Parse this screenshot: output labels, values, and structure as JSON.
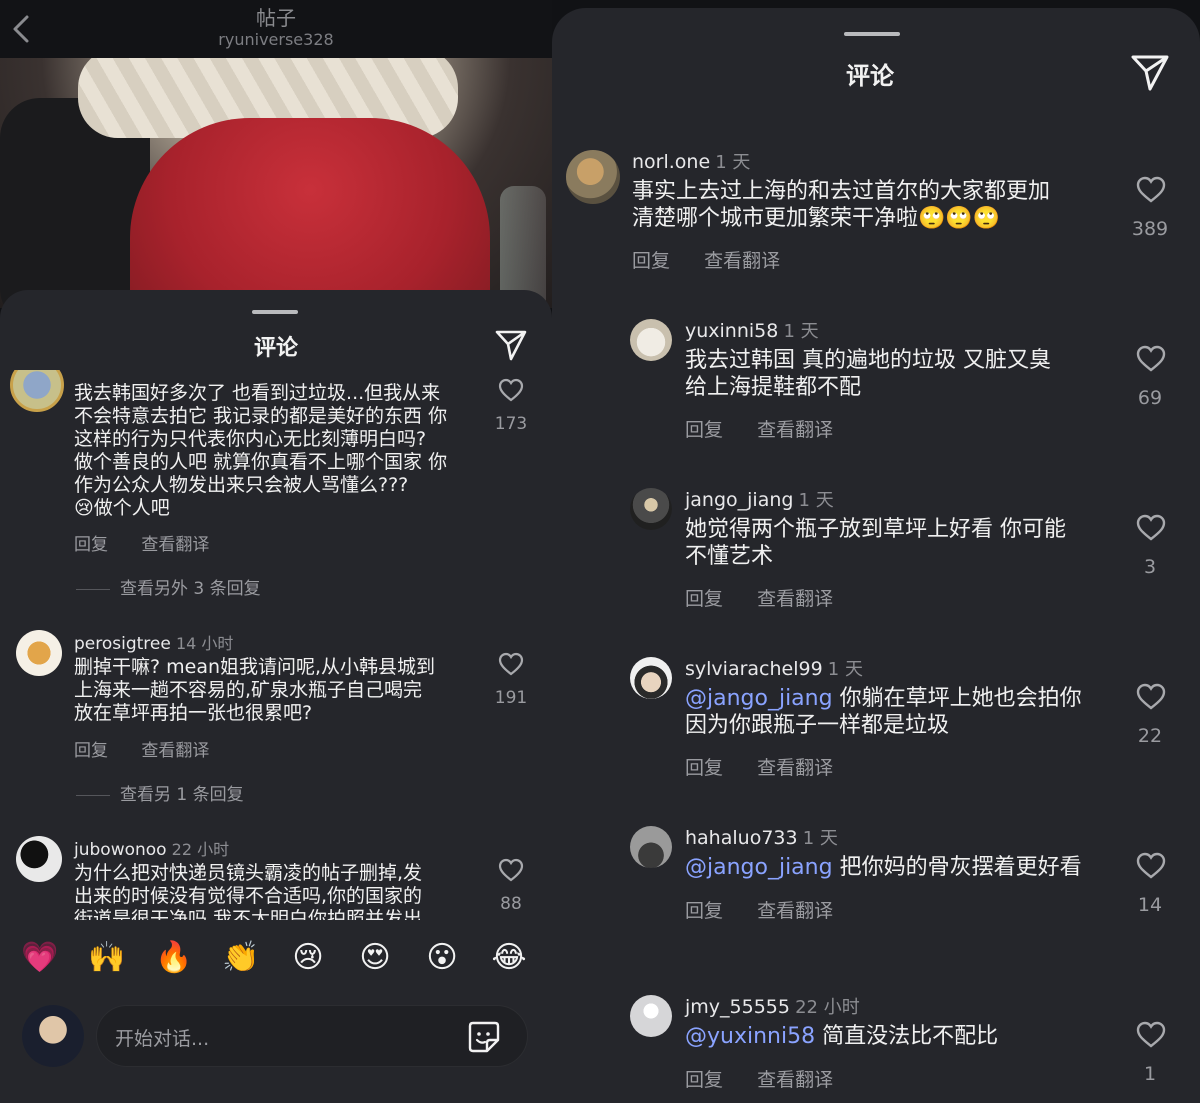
{
  "left": {
    "header": {
      "title": "帖子",
      "username": "ryuniverse328"
    },
    "sheet": {
      "title": "评论"
    },
    "comments": [
      {
        "username": "",
        "time": "",
        "text_lines": [
          "我去韩国好多次了 也看到过垃圾...但我从来",
          "不会特意去拍它 我记录的都是美好的东西 你",
          "这样的行为只代表你内心无比刻薄明白吗?",
          "做个善良的人吧 就算你真看不上哪个国家 你",
          "作为公众人物发出来只会被人骂懂么???",
          "😢做个人吧"
        ],
        "reply": "回复",
        "translate": "查看翻译",
        "likes": "173",
        "more_replies": "查看另外 3 条回复"
      },
      {
        "username": "perosigtree",
        "time": "14 小时",
        "text_lines": [
          "删掉干嘛? mean姐我请问呢,从小韩县城到",
          "上海来一趟不容易的,矿泉水瓶子自己喝完",
          "放在草坪再拍一张也很累吧?"
        ],
        "reply": "回复",
        "translate": "查看翻译",
        "likes": "191",
        "more_replies": "查看另 1 条回复"
      },
      {
        "username": "jubowonoo",
        "time": "22 小时",
        "text_lines": [
          "为什么把对快递员镜头霸凌的帖子删掉,发",
          "出来的时候没有觉得不合适吗,你的国家的",
          "街道是很干净吗 我不太明白你拍照并发出"
        ],
        "likes": "88"
      }
    ],
    "emojis": [
      "💗",
      "🙌",
      "🔥",
      "👏",
      "😢",
      "😍",
      "😮",
      "😂"
    ],
    "composer": {
      "placeholder": "开始对话..."
    }
  },
  "right": {
    "sheet": {
      "title": "评论"
    },
    "comments": [
      {
        "username": "norl.one",
        "time": "1 天",
        "mention": "",
        "text_lines": [
          "事实上去过上海的和去过首尔的大家都更加",
          "清楚哪个城市更加繁荣干净啦🙄🙄🙄"
        ],
        "reply": "回复",
        "translate": "查看翻译",
        "likes": "389"
      },
      {
        "username": "yuxinni58",
        "time": "1 天",
        "mention": "",
        "text_lines": [
          "我去过韩国 真的遍地的垃圾 又脏又臭",
          "给上海提鞋都不配"
        ],
        "reply": "回复",
        "translate": "查看翻译",
        "likes": "69"
      },
      {
        "username": "jango_jiang",
        "time": "1 天",
        "mention": "",
        "text_lines": [
          "她觉得两个瓶子放到草坪上好看 你可能",
          "不懂艺术"
        ],
        "reply": "回复",
        "translate": "查看翻译",
        "likes": "3"
      },
      {
        "username": "sylviarachel99",
        "time": "1 天",
        "mention": "@jango_jiang",
        "text_lines": [
          " 你躺在草坪上她也会拍你",
          "因为你跟瓶子一样都是垃圾"
        ],
        "reply": "回复",
        "translate": "查看翻译",
        "likes": "22"
      },
      {
        "username": "hahaluo733",
        "time": "1 天",
        "mention": "@jango_jiang",
        "text_lines": [
          " 把你妈的骨灰摆着更好看"
        ],
        "reply": "回复",
        "translate": "查看翻译",
        "likes": "14"
      },
      {
        "username": "jmy_55555",
        "time": "22 小时",
        "mention": "@yuxinni58",
        "text_lines": [
          " 简直没法比不配比"
        ],
        "reply": "回复",
        "translate": "查看翻译",
        "likes": "1"
      }
    ]
  },
  "colors": {
    "sheet_bg": "#25262b",
    "mention": "#8aa3ff",
    "muted_text": "#9a9ba0",
    "primary_text": "#f0f0f0"
  },
  "icons": [
    "back-icon",
    "send-icon",
    "heart-icon",
    "sticker-icon"
  ]
}
